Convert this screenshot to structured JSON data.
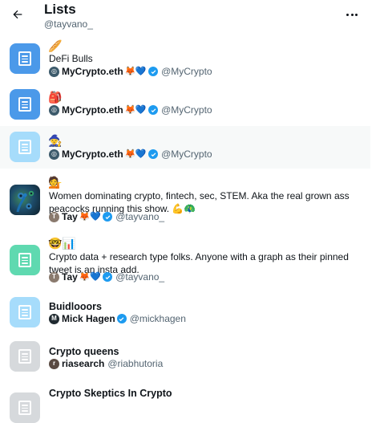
{
  "header": {
    "title": "Lists",
    "handle": "@tayvano_"
  },
  "lists": [
    {
      "emoji": "🥖",
      "name": "DeFi Bulls",
      "owner_name": "MyCrypto.eth",
      "owner_suffix": "🦊💙",
      "owner_handle": "@MyCrypto",
      "color": "#4b99e9"
    },
    {
      "emoji": "🎒",
      "owner_name": "MyCrypto.eth",
      "owner_suffix": "🦊💙",
      "owner_handle": "@MyCrypto",
      "color": "#4b99e9"
    },
    {
      "emoji": "🧙",
      "owner_name": "MyCrypto.eth",
      "owner_suffix": "🦊💙",
      "owner_handle": "@MyCrypto",
      "color": "#a6dcfb"
    },
    {
      "emoji": "💁",
      "desc": "Women dominating crypto, fintech, sec, STEM. Aka the real grown ass peacocks running this show. 💪🦚",
      "owner_name": "Tay",
      "owner_suffix": "🦊💙",
      "owner_handle": "@tayvano_"
    },
    {
      "emoji": "🤓📊",
      "desc": "Crypto data + research type folks. Anyone with a graph as their pinned tweet is an insta add.",
      "owner_name": "Tay",
      "owner_suffix": "🦊💙",
      "owner_handle": "@tayvano_",
      "color": "#5fd9b0"
    },
    {
      "name": "Buidlooors",
      "owner_name": "Mick Hagen",
      "owner_handle": "@mickhagen",
      "color": "#a6dcfb"
    },
    {
      "name": "Crypto queens",
      "owner_name": "riasearch",
      "owner_handle": "@riabhutoria",
      "color": "#d6d9dc"
    },
    {
      "name": "Crypto Skeptics In Crypto",
      "color": "#d6d9dc"
    }
  ]
}
